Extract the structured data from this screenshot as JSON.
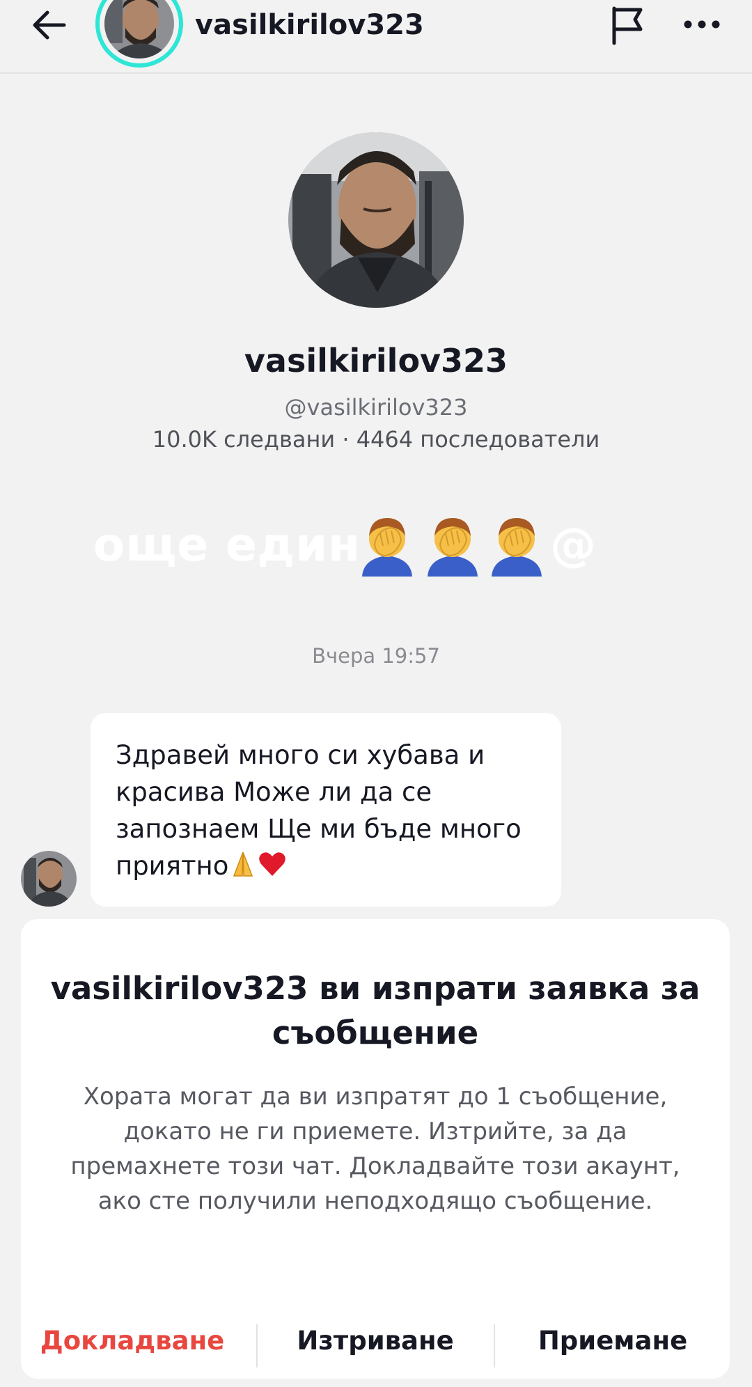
{
  "header": {
    "username": "vasilkirilov323",
    "back_icon": "arrow-left-icon",
    "flag_icon": "flag-icon",
    "more_icon": "more-horizontal-icon",
    "story_ring_color": "#2ee6d6"
  },
  "profile": {
    "name": "vasilkirilov323",
    "handle": "@vasilkirilov323",
    "stats": "10.0K следвани · 4464 последователи"
  },
  "overlay": {
    "text": "още един",
    "emoji_icon": "facepalm-emoji-icon",
    "suffix": "@"
  },
  "chat": {
    "timestamp": "Вчера 19:57",
    "message": {
      "text": "Здравей много си хубава и красива Може ли да се запознаем Ще ми бъде много приятно",
      "emojis": [
        "folded-hands-icon",
        "red-heart-icon"
      ]
    }
  },
  "request": {
    "title": "vasilkirilov323 ви изпрати заявка за съобщение",
    "description": "Хората могат да ви изпратят до 1 съобщение, докато не ги приемете. Изтрийте, за да премахнете този чат. Докладвайте този акаунт, ако сте получили неподходящо съобщение.",
    "actions": {
      "report": "Докладване",
      "delete": "Изтриване",
      "accept": "Приемане"
    },
    "report_color": "#e8473f"
  }
}
